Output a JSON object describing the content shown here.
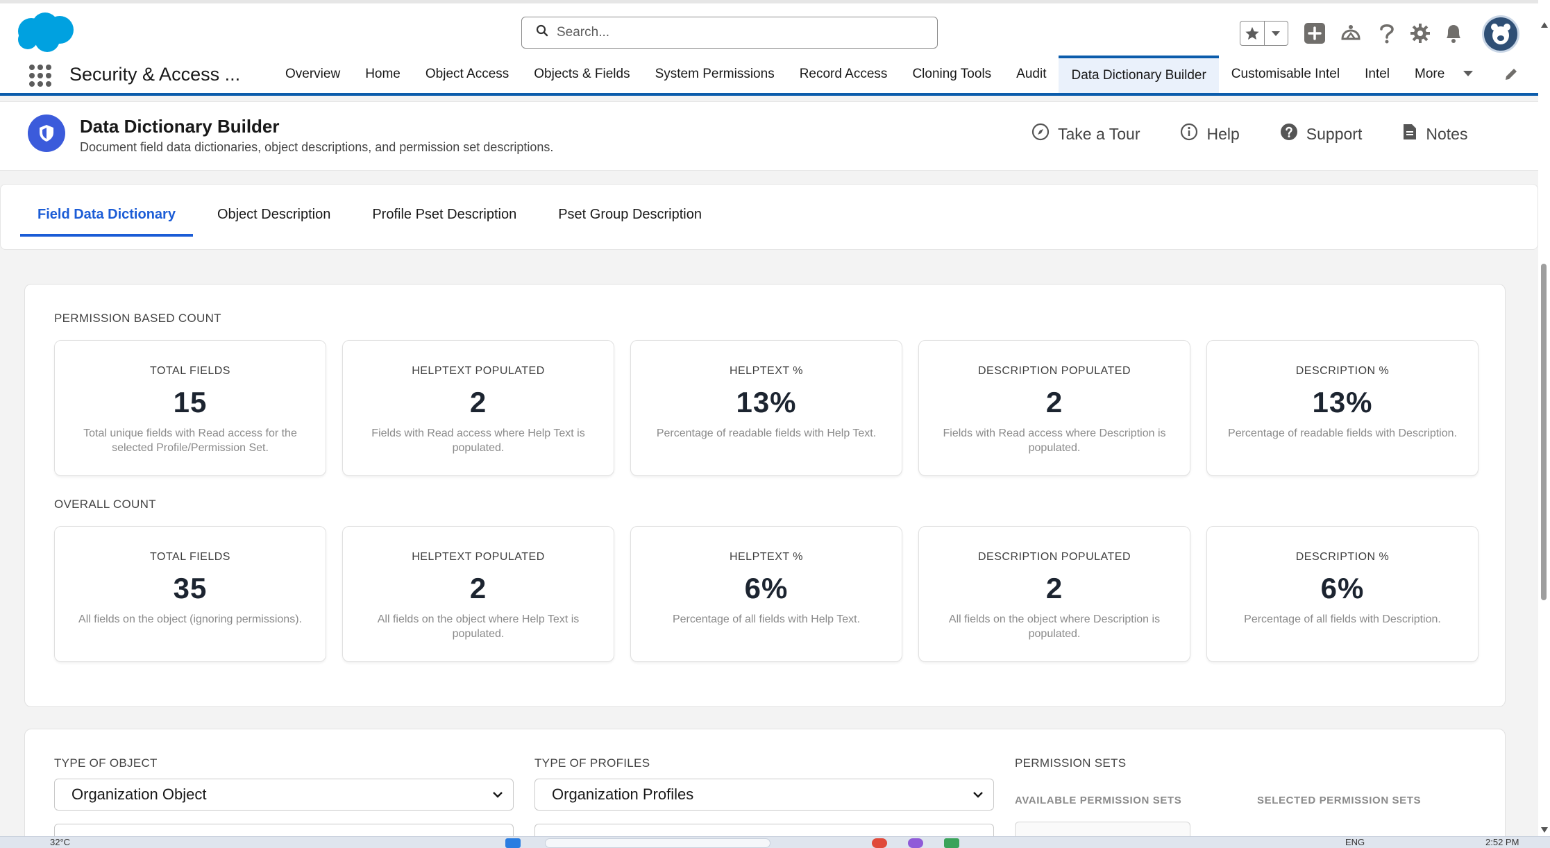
{
  "header": {
    "search_placeholder": "Search...",
    "icons": [
      "salesforce-cloud-logo",
      "search-icon",
      "star-icon",
      "chevron-down-icon",
      "plus-icon",
      "trailhead-icon",
      "question-icon",
      "gear-icon",
      "bell-icon",
      "avatar"
    ]
  },
  "nav": {
    "app_name": "Security & Access ...",
    "items": [
      {
        "label": "Overview"
      },
      {
        "label": "Home"
      },
      {
        "label": "Object Access"
      },
      {
        "label": "Objects & Fields"
      },
      {
        "label": "System Permissions"
      },
      {
        "label": "Record Access"
      },
      {
        "label": "Cloning Tools"
      },
      {
        "label": "Audit"
      },
      {
        "label": "Data Dictionary Builder",
        "active": true
      },
      {
        "label": "Customisable Intel"
      },
      {
        "label": "Intel"
      }
    ],
    "more_label": "More"
  },
  "page": {
    "title": "Data Dictionary Builder",
    "subtitle": "Document field data dictionaries, object descriptions, and permission set descriptions.",
    "actions": {
      "tour": "Take a Tour",
      "help": "Help",
      "support": "Support",
      "notes": "Notes"
    }
  },
  "tabs": [
    {
      "label": "Field Data Dictionary",
      "active": true
    },
    {
      "label": "Object Description"
    },
    {
      "label": "Profile Pset Description"
    },
    {
      "label": "Pset Group Description"
    }
  ],
  "stats": {
    "permission_label": "PERMISSION BASED COUNT",
    "permission_tiles": [
      {
        "title": "TOTAL FIELDS",
        "value": "15",
        "desc": "Total unique fields with Read access for the selected Profile/Permission Set."
      },
      {
        "title": "HELPTEXT POPULATED",
        "value": "2",
        "desc": "Fields with Read access where Help Text is populated."
      },
      {
        "title": "HELPTEXT %",
        "value": "13%",
        "desc": "Percentage of readable fields with Help Text."
      },
      {
        "title": "DESCRIPTION POPULATED",
        "value": "2",
        "desc": "Fields with Read access where Description is populated."
      },
      {
        "title": "DESCRIPTION %",
        "value": "13%",
        "desc": "Percentage of readable fields with Description."
      }
    ],
    "overall_label": "OVERALL COUNT",
    "overall_tiles": [
      {
        "title": "TOTAL FIELDS",
        "value": "35",
        "desc": "All fields on the object (ignoring permissions)."
      },
      {
        "title": "HELPTEXT POPULATED",
        "value": "2",
        "desc": "All fields on the object where Help Text is populated."
      },
      {
        "title": "HELPTEXT %",
        "value": "6%",
        "desc": "Percentage of all fields with Help Text."
      },
      {
        "title": "DESCRIPTION POPULATED",
        "value": "2",
        "desc": "All fields on the object where Description is populated."
      },
      {
        "title": "DESCRIPTION %",
        "value": "6%",
        "desc": "Percentage of all fields with Description."
      }
    ]
  },
  "filters": {
    "type_of_object_label": "TYPE OF OBJECT",
    "type_of_object_value": "Organization Object",
    "type_of_profiles_label": "TYPE OF PROFILES",
    "type_of_profiles_value": "Organization Profiles",
    "permission_sets_label": "PERMISSION SETS",
    "available_label": "AVAILABLE PERMISSION SETS",
    "selected_label": "SELECTED PERMISSION SETS"
  },
  "taskbar": {
    "weather": "32°C",
    "lang": "ENG",
    "time": "2:52 PM"
  },
  "colors": {
    "brand": "#0b5cab",
    "tab_active": "#1b5cd6",
    "icon_bg": "#3b5bdb",
    "cloud": "#00a1e0"
  }
}
